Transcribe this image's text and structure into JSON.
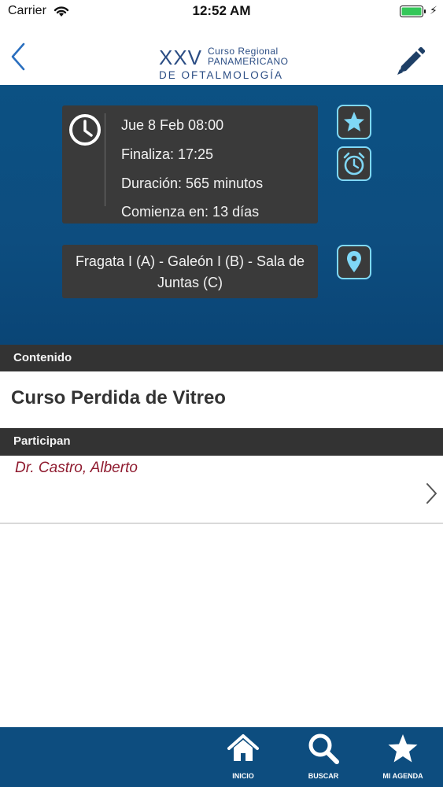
{
  "status_bar": {
    "carrier": "Carrier",
    "time": "12:52 AM"
  },
  "header": {
    "logo": {
      "roman": "XXV",
      "line1": "Curso Regional",
      "line2": "PANAMERICANO",
      "line3": "DE OFTALMOLOGÍA"
    },
    "back_icon": "chevron-left-icon",
    "edit_icon": "pencil-icon"
  },
  "event": {
    "start": "Jue 8  Feb  08:00",
    "end": "Finaliza: 17:25",
    "duration": "Duración: 565 minutos",
    "starts_in": "Comienza en: 13 días",
    "location": "Fragata I (A) - Galeón I (B) - Sala de Juntas (C)"
  },
  "sections": {
    "content_label": "Contenido",
    "course_title": "Curso Perdida de Vitreo",
    "participants_label": "Participan"
  },
  "participants": [
    {
      "name": "Dr. Castro, Alberto"
    }
  ],
  "tabbar": {
    "items": [
      {
        "label": "INICIO",
        "icon": "home-icon"
      },
      {
        "label": "BUSCAR",
        "icon": "search-icon"
      },
      {
        "label": "MI AGENDA",
        "icon": "star-icon"
      }
    ]
  },
  "colors": {
    "brand_blue": "#0d4d7f",
    "card_dark": "#3a3a3a",
    "accent_cyan": "#7fd8f7",
    "participant_red": "#8f1b2f",
    "section_header": "#333333"
  }
}
